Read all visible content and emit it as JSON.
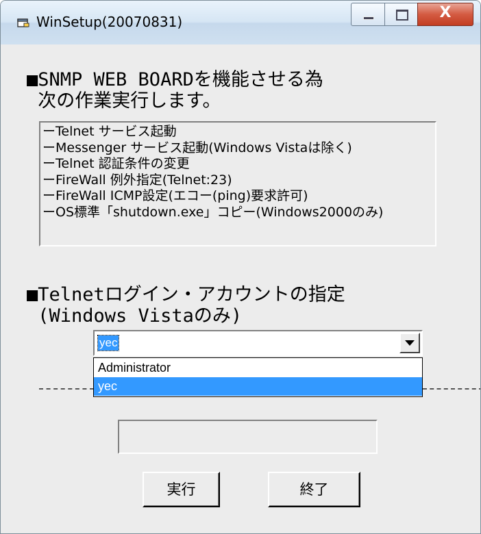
{
  "window": {
    "title": "WinSetup(20070831)",
    "close_glyph": "X"
  },
  "section1": {
    "line1": "■SNMP WEB BOARDを機能させる為",
    "line2": " 次の作業実行します。"
  },
  "tasks": [
    "ーTelnet サービス起動",
    "ーMessenger サービス起動(Windows Vistaは除く)",
    "ーTelnet 認証条件の変更",
    "ーFireWall 例外指定(Telnet:23)",
    "ーFireWall ICMP設定(エコー(ping)要求許可)",
    "ーOS標準「shutdown.exe」コピー(Windows2000のみ)"
  ],
  "section2": {
    "line1": "■Telnetログイン・アカウントの指定",
    "line2": " (Windows Vistaのみ)"
  },
  "account_combo": {
    "selected": "yec",
    "options": [
      "Administrator",
      "yec"
    ],
    "highlighted_index": 1
  },
  "status_text": "",
  "buttons": {
    "run": "実行",
    "exit": "終了"
  },
  "colors": {
    "selection": "#3399ff",
    "window_bg": "#ececec"
  }
}
